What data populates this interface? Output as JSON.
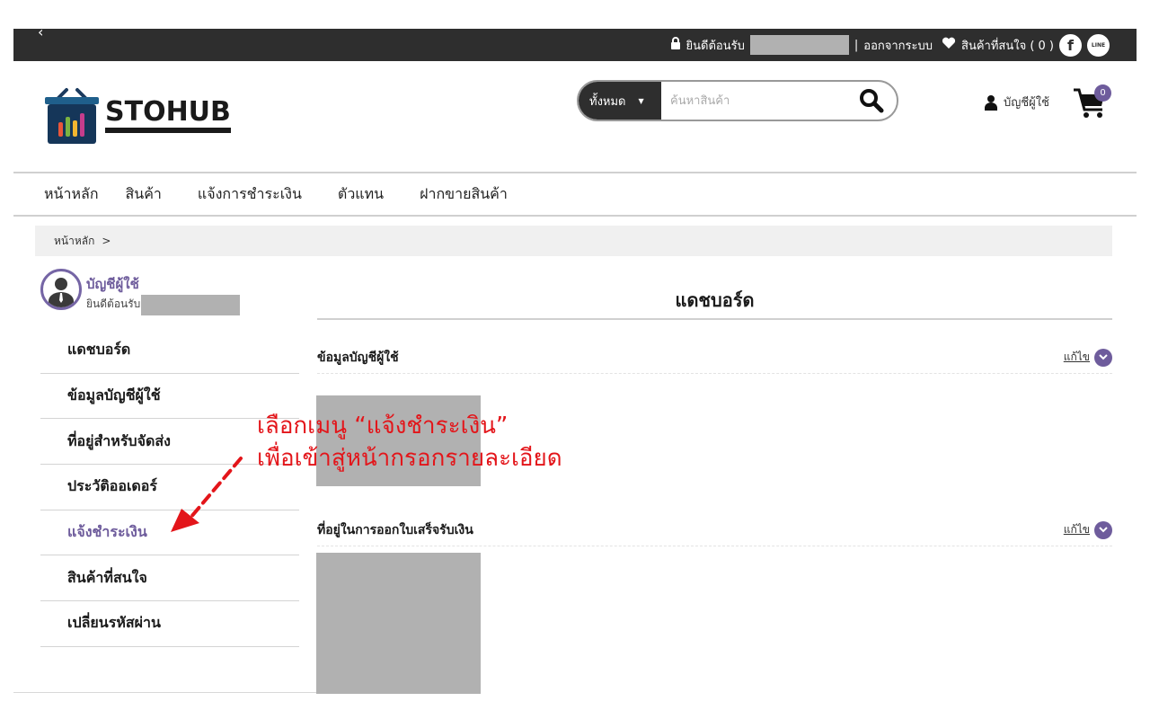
{
  "topbar": {
    "back_icon": "‹",
    "lock_icon": "lock-icon",
    "welcome": "ยินดีต้อนรับ",
    "separator": "|",
    "logout": "ออกจากระบบ",
    "heart_icon": "heart-icon",
    "wishlist": "สินค้าที่สนใจ ( 0 )",
    "facebook_icon": "facebook-icon",
    "line_icon": "line-icon",
    "line_text": "LINE"
  },
  "header": {
    "brand": "STOHUB",
    "search": {
      "category": "ทั้งหมด",
      "placeholder": "ค้นหาสินค้า"
    },
    "account_label": "บัญชีผู้ใช้",
    "cart_count": "0"
  },
  "nav": {
    "items": [
      {
        "label": "หน้าหลัก"
      },
      {
        "label": "สินค้า"
      },
      {
        "label": "แจ้งการชำระเงิน"
      },
      {
        "label": "ตัวแทน"
      },
      {
        "label": "ฝากขายสินค้า"
      }
    ]
  },
  "breadcrumb": {
    "home": "หน้าหลัก",
    "separator": ">"
  },
  "sidebar": {
    "title": "บัญชีผู้ใช้",
    "welcome": "ยินดีต้อนรับ",
    "menu": [
      {
        "label": "แดชบอร์ด",
        "active": false
      },
      {
        "label": "ข้อมูลบัญชีผู้ใช้",
        "active": false
      },
      {
        "label": "ที่อยู่สำหรับจัดส่ง",
        "active": false
      },
      {
        "label": "ประวัติออเดอร์",
        "active": false
      },
      {
        "label": "แจ้งชำระเงิน",
        "active": true
      },
      {
        "label": "สินค้าที่สนใจ",
        "active": false
      },
      {
        "label": "เปลี่ยนรหัสผ่าน",
        "active": false
      }
    ]
  },
  "main": {
    "title": "แดชบอร์ด",
    "sections": [
      {
        "heading": "ข้อมูลบัญชีผู้ใช้",
        "edit": "แก้ไข"
      },
      {
        "heading": "ที่อยู่ในการออกใบเสร็จรับเงิน",
        "edit": "แก้ไข"
      }
    ]
  },
  "annotation": {
    "line1": "เลือกเมนู “แจ้งชำระเงิน”",
    "line2": "เพื่อเข้าสู่หน้ากรอกรายละเอียด"
  },
  "colors": {
    "accent": "#6e5c9c",
    "topbar": "#2e2e2e",
    "annotation": "#e3151a",
    "redaction": "#b1b1b1"
  }
}
